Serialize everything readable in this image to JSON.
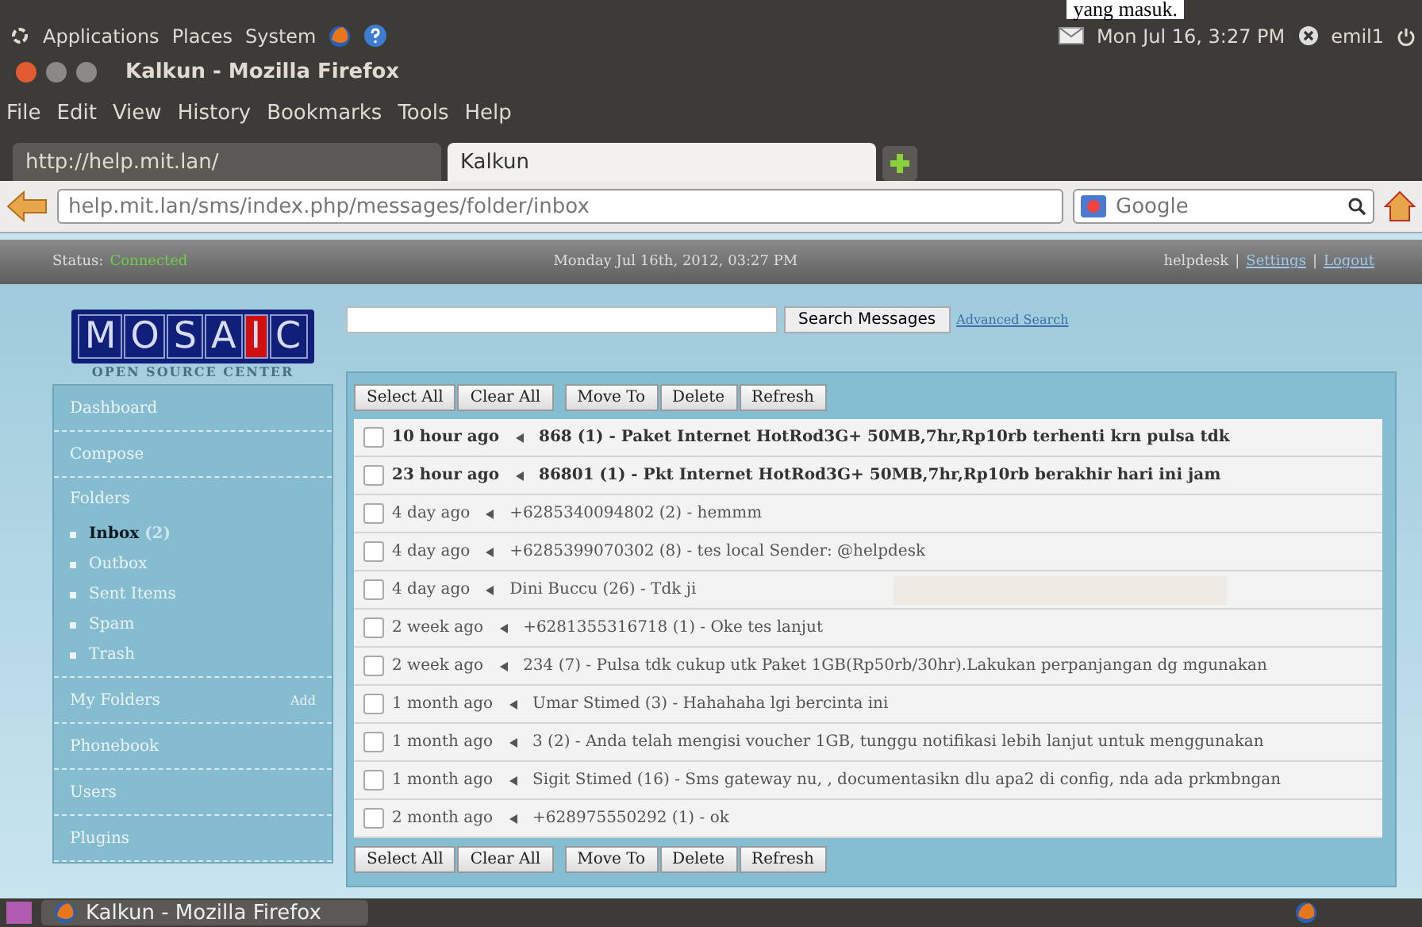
{
  "overlay_text": "yang masuk.",
  "panel": {
    "menus": [
      "Applications",
      "Places",
      "System"
    ],
    "clock": "Mon Jul 16,  3:27 PM",
    "user": "emil1"
  },
  "window": {
    "title": "Kalkun - Mozilla Firefox"
  },
  "menubar": [
    "File",
    "Edit",
    "View",
    "History",
    "Bookmarks",
    "Tools",
    "Help"
  ],
  "tabs": [
    {
      "label": "http://help.mit.lan/",
      "selected": false
    },
    {
      "label": "Kalkun",
      "selected": true
    }
  ],
  "address": "help.mit.lan/sms/index.php/messages/folder/inbox",
  "search": {
    "placeholder": "Google"
  },
  "statusbar": {
    "label": "Status:",
    "status": "Connected",
    "date": "Monday Jul 16th, 2012, 03:27 PM",
    "user": "helpdesk",
    "separator": "|",
    "links": [
      "Settings",
      "Logout"
    ]
  },
  "logo": {
    "letters": [
      "M",
      "O",
      "S",
      "A",
      "I",
      "C"
    ],
    "tagline": "OPEN SOURCE CENTER"
  },
  "search_messages": {
    "button": "Search Messages",
    "link": "Advanced Search"
  },
  "sidebar": [
    {
      "kind": "item",
      "label": "Dashboard"
    },
    {
      "kind": "item",
      "label": "Compose"
    },
    {
      "kind": "folders",
      "label": "Folders",
      "children": [
        {
          "label": "Inbox",
          "count": "(2)",
          "selected": true
        },
        {
          "label": "Outbox",
          "selected": false
        },
        {
          "label": "Sent Items",
          "selected": false
        },
        {
          "label": "Spam",
          "selected": false
        },
        {
          "label": "Trash",
          "selected": false
        }
      ]
    },
    {
      "kind": "item",
      "label": "My Folders",
      "action": "Add"
    },
    {
      "kind": "item",
      "label": "Phonebook"
    },
    {
      "kind": "item",
      "label": "Users"
    },
    {
      "kind": "item",
      "label": "Plugins"
    }
  ],
  "toolbar": [
    "Select All",
    "Clear All",
    "Move To",
    "Delete",
    "Refresh"
  ],
  "messages": [
    {
      "time": "10 hour ago",
      "text": "868 (1) - Paket Internet HotRod3G+ 50MB,7hr,Rp10rb terhenti krn pulsa tdk",
      "unread": true,
      "checked": false
    },
    {
      "time": "23 hour ago",
      "text": "86801 (1) - Pkt Internet HotRod3G+ 50MB,7hr,Rp10rb berakhir hari ini jam",
      "unread": true,
      "checked": false
    },
    {
      "time": "4 day ago",
      "text": "+6285340094802 (2) - hemmm",
      "unread": false,
      "checked": false
    },
    {
      "time": "4 day ago",
      "text": "+6285399070302 (8) - tes local Sender: @helpdesk",
      "unread": false,
      "checked": false
    },
    {
      "time": "4 day ago",
      "text": "Dini Buccu (26) - Tdk ji",
      "unread": false,
      "checked": false,
      "redacted": true
    },
    {
      "time": "2 week ago",
      "text": "+6281355316718 (1) - Oke tes lanjut",
      "unread": false,
      "checked": false
    },
    {
      "time": "2 week ago",
      "text": "234 (7) - Pulsa tdk cukup utk Paket 1GB(Rp50rb/30hr).Lakukan perpanjangan dg mgunakan",
      "unread": false,
      "checked": false
    },
    {
      "time": "1 month ago",
      "text": "Umar Stimed (3) - Hahahaha lgi bercinta ini",
      "unread": false,
      "checked": false
    },
    {
      "time": "1 month ago",
      "text": "3 (2) - Anda telah mengisi voucher 1GB, tunggu notifikasi lebih lanjut untuk menggunakan",
      "unread": false,
      "checked": false
    },
    {
      "time": "1 month ago",
      "text": "Sigit Stimed (16) - Sms gateway nu, , documentasikn dlu apa2 di config, nda ada prkmbngan",
      "unread": false,
      "checked": false
    },
    {
      "time": "2 month ago",
      "text": "+628975550292 (1) - ok",
      "unread": false,
      "checked": false
    }
  ],
  "toolbar_bottom": [
    "Select All",
    "Clear All",
    "Move To",
    "Delete",
    "Refresh"
  ],
  "taskbar": {
    "window": "Kalkun - Mozilla Firefox"
  }
}
